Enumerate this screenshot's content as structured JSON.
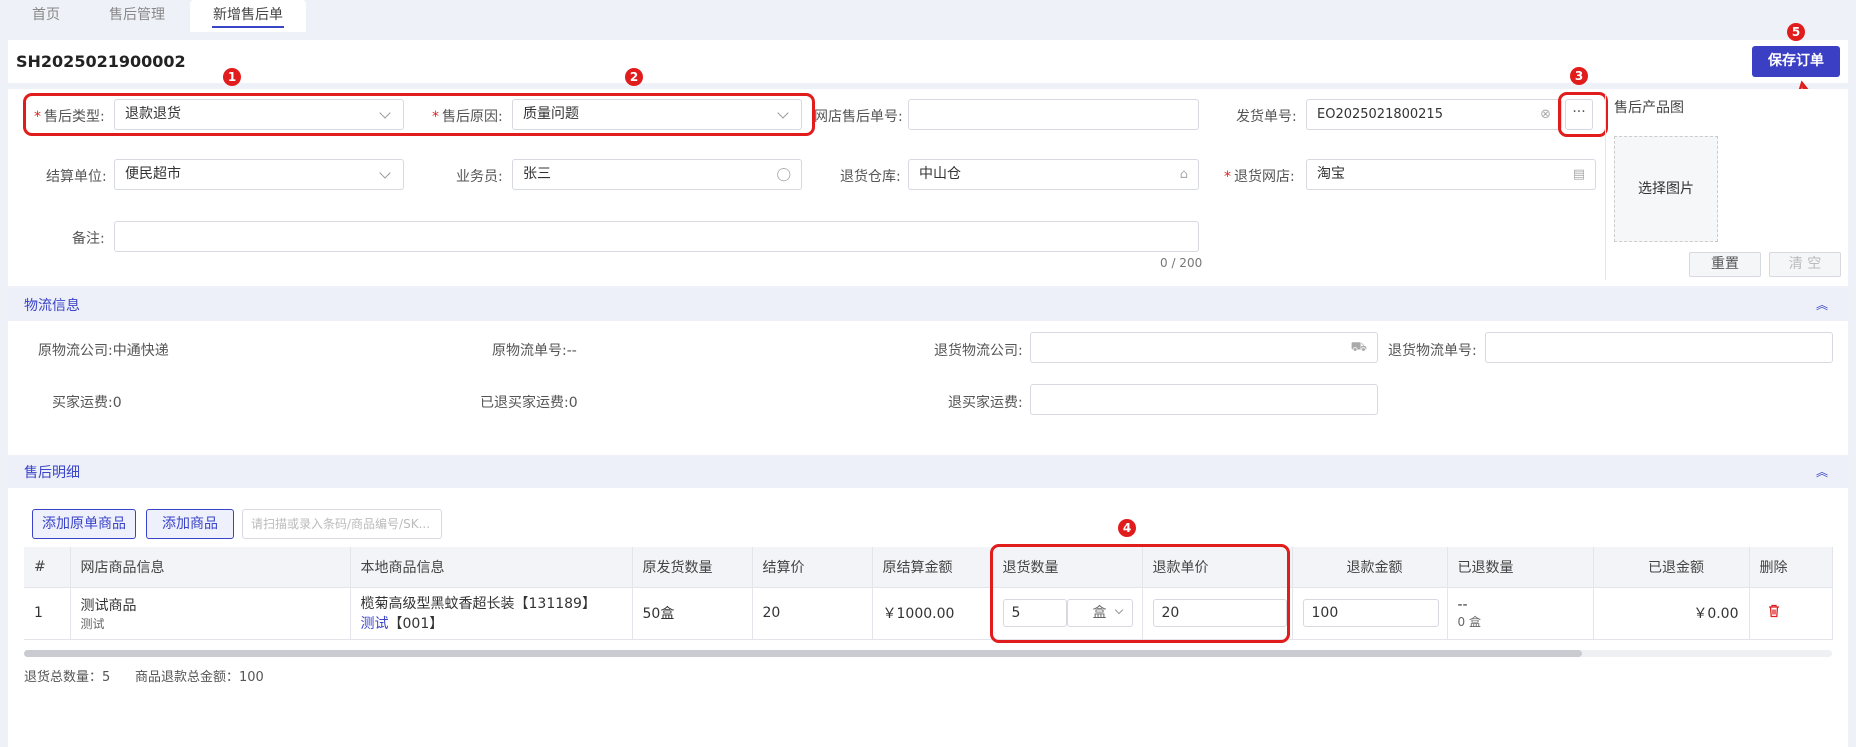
{
  "tabs": [
    {
      "label": "首页"
    },
    {
      "label": "售后管理"
    },
    {
      "label": "新增售后单"
    }
  ],
  "header": {
    "order_no": "SH2025021900002",
    "save_label": "保存订单"
  },
  "form": {
    "aftersale_type": {
      "label": "售后类型:",
      "value": "退款退货"
    },
    "aftersale_reason": {
      "label": "售后原因:",
      "value": "质量问题"
    },
    "shop_aftersale_no": {
      "label": "网店售后单号:",
      "value": ""
    },
    "delivery_no": {
      "label": "发货单号:",
      "value": "EO2025021800215"
    },
    "settle_unit": {
      "label": "结算单位:",
      "value": "便民超市"
    },
    "salesman": {
      "label": "业务员:",
      "value": "张三"
    },
    "return_warehouse": {
      "label": "退货仓库:",
      "value": "中山仓"
    },
    "return_shop": {
      "label": "退货网店:",
      "value": "淘宝"
    },
    "remark": {
      "label": "备注:",
      "value": "",
      "counter": "0 / 200"
    },
    "product_image_label": "售后产品图",
    "choose_image": "选择图片",
    "reset": "重置",
    "clear": "清 空",
    "more_btn": "···"
  },
  "annotations": [
    "1",
    "2",
    "3",
    "4",
    "5"
  ],
  "logistics": {
    "title": "物流信息",
    "orig_company_label": "原物流公司:",
    "orig_company": "中通快递",
    "orig_no_label": "原物流单号:",
    "orig_no": "--",
    "return_company_label": "退货物流公司:",
    "return_company": "",
    "return_no_label": "退货物流单号:",
    "return_no": "",
    "buyer_freight_label": "买家运费:",
    "buyer_freight": "0",
    "refunded_freight_label": "已退买家运费:",
    "refunded_freight": "0",
    "refund_buyer_freight_label": "退买家运费:",
    "refund_buyer_freight": ""
  },
  "details": {
    "title": "售后明细",
    "add_original_btn": "添加原单商品",
    "add_goods_btn": "添加商品",
    "scan_placeholder": "请扫描或录入条码/商品编号/SK...",
    "columns": [
      "#",
      "网店商品信息",
      "本地商品信息",
      "原发货数量",
      "结算价",
      "原结算金额",
      "退货数量",
      "退款单价",
      "退款金额",
      "已退数量",
      "已退金额",
      "删除"
    ],
    "rows": [
      {
        "idx": "1",
        "shop_goods": "测试商品",
        "shop_goods_sub": "测试",
        "local_goods": "榄菊高级型黑蚊香超长装【131189】",
        "local_goods_link": "测试",
        "local_goods_code": "【001】",
        "orig_qty": "50盒",
        "settle_price": "20",
        "orig_amount": "￥1000.00",
        "return_qty": "5",
        "return_unit": "盒",
        "refund_price": "20",
        "refund_amount": "100",
        "refunded_qty": "--",
        "refunded_qty_sub": "0 盒",
        "refunded_amount": "￥0.00"
      }
    ],
    "summary_qty": "退货总数量：5",
    "summary_amount": "商品退款总金额：100"
  },
  "colors": {
    "accent": "#3a44c8",
    "annotation_red": "#e11c1c",
    "amount_orange": "#f08c00"
  }
}
